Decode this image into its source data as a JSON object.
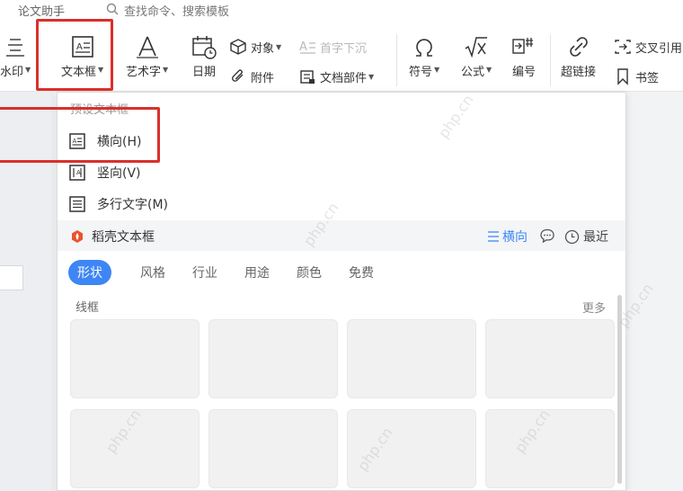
{
  "app": {
    "top_left_text": "论文助手",
    "search_text": "查找命令、搜索模板"
  },
  "ribbon": {
    "watermark": "水印",
    "textbox": "文本框",
    "art_text": "艺术字",
    "date": "日期",
    "object": "对象",
    "attachment": "附件",
    "drop_cap": "首字下沉",
    "doc_parts": "文档部件",
    "symbol": "符号",
    "formula": "公式",
    "numbering": "编号",
    "hyperlink": "超链接",
    "cross_ref": "交叉引用",
    "bookmark": "书签"
  },
  "dropdown": {
    "section_title": "预设文本框",
    "items": [
      {
        "label": "横向(H)"
      },
      {
        "label": "竖向(V)"
      },
      {
        "label": "多行文字(M)"
      }
    ],
    "brand_label": "稻壳文本框",
    "orientation_label": "横向",
    "recent_label": "最近",
    "tabs": [
      "形状",
      "风格",
      "行业",
      "用途",
      "颜色",
      "免费"
    ],
    "active_tab": "形状",
    "subhead": "线框",
    "more_label": "更多"
  },
  "colors": {
    "accent": "#3e86f5",
    "highlight": "#d9302a",
    "brand": "#e8542f"
  }
}
